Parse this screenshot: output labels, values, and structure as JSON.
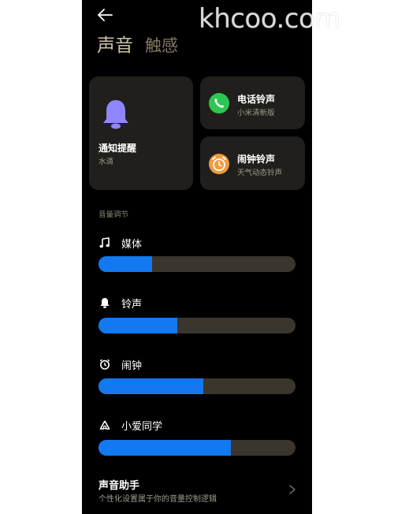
{
  "watermark": "khcoo.com",
  "header": {
    "back_icon": "arrow-left-icon",
    "tabs": [
      {
        "label": "声音",
        "active": true
      },
      {
        "label": "触感",
        "active": false
      }
    ]
  },
  "cards": {
    "notification": {
      "title": "通知提醒",
      "subtitle": "水滴",
      "icon": "bell-icon",
      "icon_color": "#8f86ff"
    },
    "ringtone": {
      "title": "电话铃声",
      "subtitle": "小米清新版",
      "icon": "phone-icon",
      "icon_color": "#2dc653"
    },
    "alarm": {
      "title": "闹钟铃声",
      "subtitle": "天气动态铃声",
      "icon": "alarm-clock-icon",
      "icon_color": "#f09a3e"
    }
  },
  "volume": {
    "section_label": "音量调节",
    "items": [
      {
        "label": "媒体",
        "icon": "music-note-icon",
        "level": 0.27
      },
      {
        "label": "铃声",
        "icon": "bell-icon",
        "level": 0.4
      },
      {
        "label": "闹钟",
        "icon": "alarm-clock-icon",
        "level": 0.53
      },
      {
        "label": "小爱同学",
        "icon": "xiaoai-icon",
        "level": 0.67
      }
    ]
  },
  "assistant": {
    "title": "声音助手",
    "subtitle": "个性化设置属于你的音量控制逻辑",
    "icon": "chevron-right-icon"
  },
  "colors": {
    "background": "#000000",
    "card": "#201f1c",
    "slider_track": "#3a362d",
    "slider_fill": "#1279f0",
    "accent_tab": "#cfc3a7"
  }
}
